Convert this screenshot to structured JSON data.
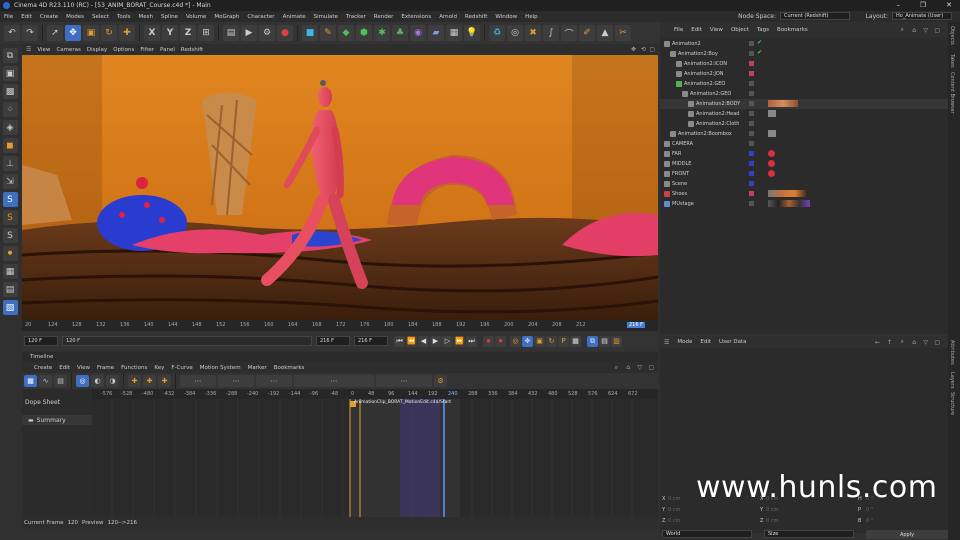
{
  "window": {
    "title": "Cinema 4D R23.110 (RC) - [53_ANIM_BORAT_Course.c4d *] - Main",
    "minimize": "–",
    "maximize": "❐",
    "close": "✕"
  },
  "menu": {
    "items": [
      "File",
      "Edit",
      "Create",
      "Modes",
      "Select",
      "Tools",
      "Mesh",
      "Spline",
      "Volume",
      "MoGraph",
      "Character",
      "Animate",
      "Simulate",
      "Tracker",
      "Render",
      "Extensions",
      "Arnold",
      "Redshift",
      "Window",
      "Help"
    ],
    "node_space_label": "Node Space:",
    "node_space_value": "Current (Redshift)",
    "layout_label": "Layout:",
    "layout_value": "Ho_Animate (User)"
  },
  "viewport": {
    "menu": [
      "View",
      "Cameras",
      "Display",
      "Options",
      "Filter",
      "Panel",
      "Redshift"
    ]
  },
  "timeline_ruler": {
    "ticks": [
      "20",
      "124",
      "128",
      "132",
      "136",
      "140",
      "144",
      "148",
      "152",
      "156",
      "160",
      "164",
      "168",
      "172",
      "176",
      "180",
      "184",
      "188",
      "192",
      "196",
      "200",
      "204",
      "208",
      "212",
      "216 F"
    ]
  },
  "playback": {
    "start_field": "120 F",
    "start_field2": "120 F",
    "end_field": "216 F",
    "end_field2": "216 F"
  },
  "timeline": {
    "header": "Timeline",
    "menu": [
      "Create",
      "Edit",
      "View",
      "Frame",
      "Functions",
      "Key",
      "F-Curve",
      "Motion System",
      "Marker",
      "Bookmarks"
    ],
    "dope_sheet_label": "Dope Sheet",
    "summary_label": "Summary",
    "ruler_ticks": [
      "-576",
      "-528",
      "-480",
      "-432",
      "-384",
      "-336",
      "-288",
      "-240",
      "-192",
      "-144",
      "-96",
      "-48",
      "0",
      "48",
      "96",
      "144",
      "192",
      "240",
      "288",
      "336",
      "384",
      "432",
      "480",
      "528",
      "576",
      "624",
      "672"
    ],
    "clip_label": "AnimationClip_BORAT_MotionEdit.c4d/Start"
  },
  "status": {
    "current_frame_label": "Current Frame",
    "current_frame_value": "120",
    "preview_label": "Preview",
    "preview_value": "120-->216"
  },
  "objects": {
    "menu": [
      "File",
      "Edit",
      "View",
      "Object",
      "Tags",
      "Bookmarks"
    ],
    "rows": [
      {
        "label": "Animation2",
        "indent": 0,
        "color": "#8a8a8a"
      },
      {
        "label": "Animation2:Boy",
        "indent": 1,
        "color": "#8a8a8a"
      },
      {
        "label": "Animation2:ICON",
        "indent": 2,
        "color": "#8a8a8a"
      },
      {
        "label": "Animation2:JON",
        "indent": 2,
        "color": "#8a8a8a"
      },
      {
        "label": "Animation2:GEO",
        "indent": 2,
        "color": "#58b04f"
      },
      {
        "label": "Animation2:GEO",
        "indent": 3,
        "color": "#8a8a8a"
      },
      {
        "label": "Animation2:BODY",
        "indent": 4,
        "color": "#8a8a8a"
      },
      {
        "label": "Animation2:Head",
        "indent": 4,
        "color": "#8a8a8a"
      },
      {
        "label": "Animation2:Cloth",
        "indent": 4,
        "color": "#8a8a8a"
      },
      {
        "label": "Animation2:Boombox",
        "indent": 1,
        "color": "#8a8a8a"
      },
      {
        "label": "CAMERA",
        "indent": 0,
        "color": "#8a8a8a"
      },
      {
        "label": "FAR",
        "indent": 0,
        "color": "#8a8a8a"
      },
      {
        "label": "MIDDLE",
        "indent": 0,
        "color": "#8a8a8a"
      },
      {
        "label": "FRONT",
        "indent": 0,
        "color": "#8a8a8a"
      },
      {
        "label": "Scene",
        "indent": 0,
        "color": "#8a8a8a"
      },
      {
        "label": "Shoes",
        "indent": 0,
        "color": "#d04040"
      },
      {
        "label": "MUstage",
        "indent": 0,
        "color": "#5c8fd0"
      }
    ]
  },
  "attributes": {
    "menu": [
      "Mode",
      "Edit",
      "User Data"
    ]
  },
  "coords": {
    "labels": [
      "X",
      "Y",
      "Z",
      "X",
      "Y",
      "Z",
      "H",
      "P",
      "B"
    ],
    "values": [
      "0 cm",
      "0 cm",
      "0 cm",
      "0 cm",
      "0 cm",
      "0 cm",
      "0 °",
      "0 °",
      "0 °"
    ],
    "mode_left": "World",
    "mode_mid": "Size",
    "apply_label": "Apply"
  },
  "right_tabs": [
    "Objects",
    "Takes",
    "Content Browser",
    "Attributes",
    "Layers",
    "Structure"
  ],
  "watermark": "www.hunls.com",
  "colors": {
    "viewport_bg": "#d9801b",
    "character": "#e04a5a",
    "accent_blue": "#3f6fc2",
    "playhead": "#4a7fd0"
  }
}
